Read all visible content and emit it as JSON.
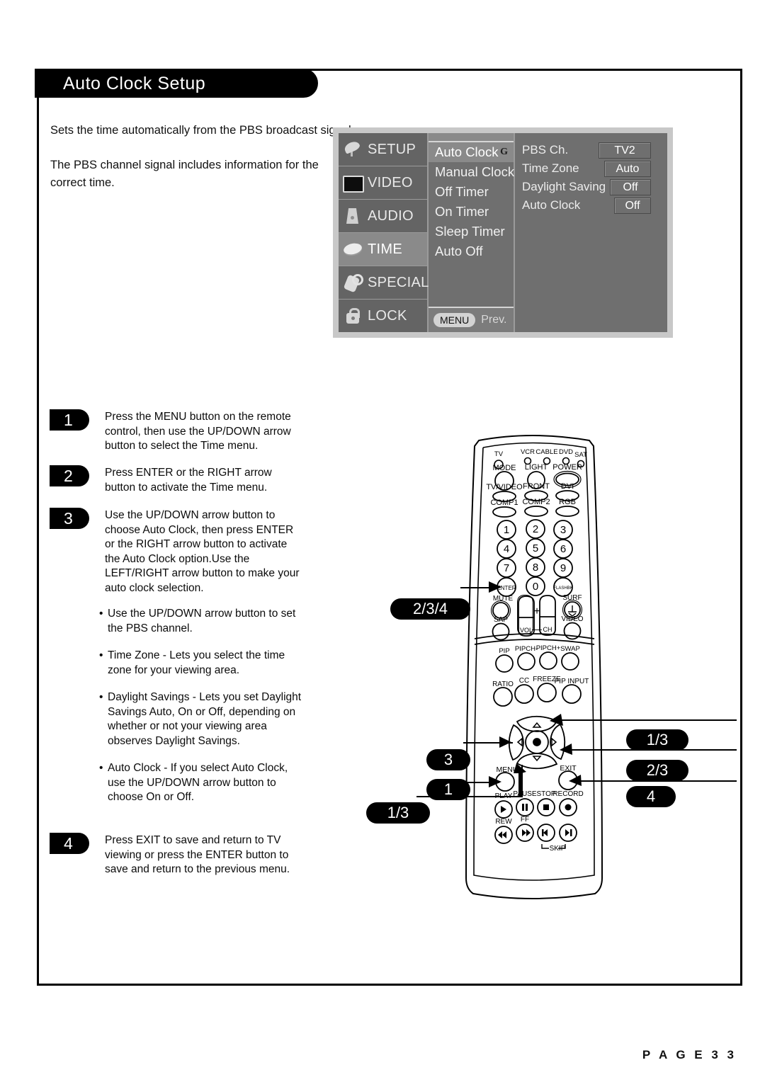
{
  "page": {
    "title": "Auto Clock Setup",
    "page_number": "P A G E   3 3",
    "intro_1": "Sets the time automatically from the PBS broadcast signal.",
    "intro_2": "The PBS channel signal includes information for the correct time."
  },
  "osd": {
    "sidebar": [
      {
        "label": "SETUP",
        "icon": "satellite-dish-icon",
        "active": false
      },
      {
        "label": "VIDEO",
        "icon": "tv-screen-icon",
        "active": false
      },
      {
        "label": "AUDIO",
        "icon": "speaker-icon",
        "active": false
      },
      {
        "label": "TIME",
        "icon": "clock-disc-icon",
        "active": true
      },
      {
        "label": "SPECIAL",
        "icon": "tag-icon",
        "active": false
      },
      {
        "label": "LOCK",
        "icon": "padlock-icon",
        "active": false
      }
    ],
    "menu_items": [
      {
        "label": "Auto Clock",
        "selected": true,
        "marker": "G"
      },
      {
        "label": "Manual Clock",
        "selected": false,
        "marker": ""
      },
      {
        "label": "Off Timer",
        "selected": false,
        "marker": ""
      },
      {
        "label": "On Timer",
        "selected": false,
        "marker": ""
      },
      {
        "label": "Sleep Timer",
        "selected": false,
        "marker": ""
      },
      {
        "label": "Auto Off",
        "selected": false,
        "marker": ""
      }
    ],
    "footer": {
      "button": "MENU",
      "action": "Prev."
    },
    "settings": [
      {
        "label": "PBS Ch.",
        "value": "TV2"
      },
      {
        "label": "Time Zone",
        "value": "Auto"
      },
      {
        "label": "Daylight Saving",
        "value": "Off"
      },
      {
        "label": "Auto Clock",
        "value": "Off"
      }
    ]
  },
  "steps": [
    {
      "num": "1",
      "text": "Press the MENU button on the remote control, then use the UP/DOWN arrow button to select the Time menu."
    },
    {
      "num": "2",
      "text": "Press ENTER or the RIGHT arrow button to activate the Time menu."
    },
    {
      "num": "3",
      "text": "Use the UP/DOWN arrow button to choose Auto Clock, then press ENTER or the RIGHT arrow button to activate the Auto Clock option.Use the LEFT/RIGHT arrow button to make your auto clock selection."
    },
    {
      "num": "4",
      "text": "Press EXIT to save and return to TV viewing or press the ENTER button to save and return to the previous menu."
    }
  ],
  "bullets": [
    "Use the UP/DOWN arrow button to set the PBS channel.",
    "Time Zone - Lets you select the time zone for your viewing area.",
    "Daylight Savings - Lets you set Daylight Savings Auto, On or Off, depending on whether or not your viewing area observes Daylight Savings.",
    "Auto Clock - If you select Auto Clock, use the UP/DOWN arrow button  to choose On or Off."
  ],
  "remote": {
    "mode_leds": [
      "TV",
      "VCR",
      "CABLE",
      "DVD",
      "SAT"
    ],
    "row_mode": [
      "MODE",
      "LIGHT",
      "POWER"
    ],
    "row_input1": [
      "TV/VIDEO",
      "FRONT",
      "DVI"
    ],
    "row_input2": [
      "COMP1",
      "COMP2",
      "RGB"
    ],
    "keypad": [
      "1",
      "2",
      "3",
      "4",
      "5",
      "6",
      "7",
      "8",
      "9",
      "ENTER",
      "0",
      "FLASHBK"
    ],
    "row_mute": [
      "MUTE",
      "SURF"
    ],
    "row_sap": [
      "SAP",
      "VIDEO"
    ],
    "rockers": [
      "VOL",
      "CH",
      "+",
      "—"
    ],
    "row_pip": [
      "PIP",
      "PIPCH-",
      "PIPCH+",
      "SWAP"
    ],
    "row_ratio": [
      "RATIO",
      "CC",
      "FREEZE",
      "PIP INPUT"
    ],
    "nav": {
      "menu": "MENU",
      "exit": "EXIT"
    },
    "row_play": [
      "PLAY",
      "PAUSE",
      "STOP",
      "RECORD"
    ],
    "row_rew": [
      "REW",
      "FF"
    ],
    "skip": "SKIP"
  },
  "callouts": [
    {
      "id": "enter",
      "label": "2/3/4"
    },
    {
      "id": "up",
      "label": "1/3"
    },
    {
      "id": "left",
      "label": "3"
    },
    {
      "id": "right",
      "label": "2/3"
    },
    {
      "id": "menu",
      "label": "1"
    },
    {
      "id": "exit",
      "label": "4"
    },
    {
      "id": "down",
      "label": "1/3"
    }
  ]
}
